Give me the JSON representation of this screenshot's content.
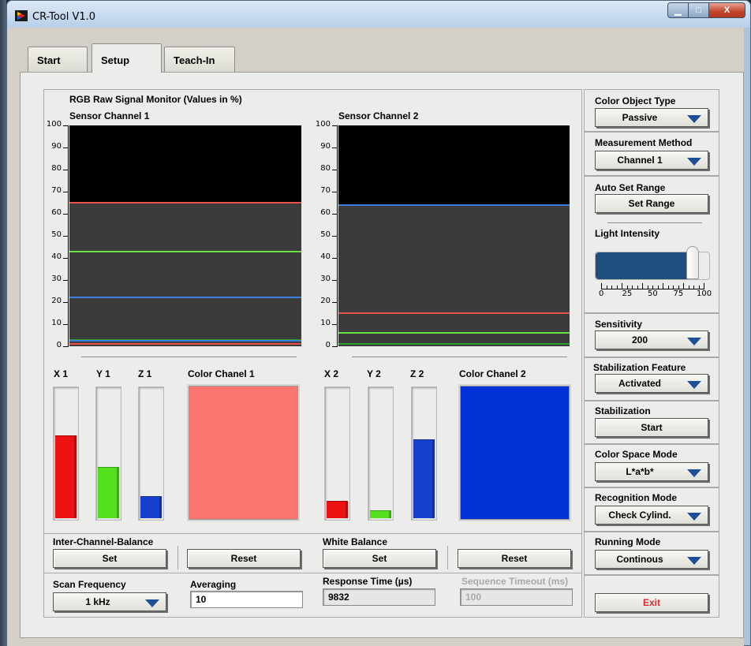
{
  "window": {
    "title": "CR-Tool V1.0",
    "min_glyph": "▁",
    "max_glyph": "□",
    "close_glyph": "X"
  },
  "tabs": [
    {
      "label": "Start",
      "active": false
    },
    {
      "label": "Setup",
      "active": true
    },
    {
      "label": "Teach-In",
      "active": false
    }
  ],
  "monitor": {
    "title": "RGB Raw Signal Monitor (Values in %)",
    "y_ticks": [
      "100",
      "90",
      "80",
      "70",
      "60",
      "50",
      "40",
      "30",
      "20",
      "10",
      "0"
    ]
  },
  "chart_data": [
    {
      "type": "line",
      "title": "Sensor Channel 1",
      "ylim": [
        0,
        100
      ],
      "y_ticks": [
        0,
        10,
        20,
        30,
        40,
        50,
        60,
        70,
        80,
        90,
        100
      ],
      "series": [
        {
          "color": "#e8504a",
          "value": 65
        },
        {
          "color": "#66e040",
          "value": 43
        },
        {
          "color": "#3d7fe0",
          "value": 22
        },
        {
          "color": "#2a9a2a",
          "value": 3
        },
        {
          "color": "#3d7fe0",
          "value": 2.5
        },
        {
          "color": "#e8504a",
          "value": 1
        }
      ],
      "fill_level": 65
    },
    {
      "type": "line",
      "title": "Sensor Channel 2",
      "ylim": [
        0,
        100
      ],
      "y_ticks": [
        0,
        10,
        20,
        30,
        40,
        50,
        60,
        70,
        80,
        90,
        100
      ],
      "series": [
        {
          "color": "#3d7fe0",
          "value": 64
        },
        {
          "color": "#e8504a",
          "value": 15
        },
        {
          "color": "#66e040",
          "value": 6
        },
        {
          "color": "#2a9a2a",
          "value": 1
        }
      ],
      "fill_level": 64
    }
  ],
  "channel1": {
    "x_label": "X 1",
    "y_label": "Y 1",
    "z_label": "Z 1",
    "swatch_label": "Color Chanel 1",
    "x_level": 0.63,
    "y_level": 0.39,
    "z_level": 0.17,
    "swatch_color": "#fb766e"
  },
  "channel2": {
    "x_label": "X 2",
    "y_label": "Y 2",
    "z_label": "Z 2",
    "swatch_label": "Color Chanel 2",
    "x_level": 0.13,
    "y_level": 0.06,
    "z_level": 0.6,
    "swatch_color": "#0331d8"
  },
  "colors": {
    "bar_red": "#ee1111",
    "bar_green": "#55e01e",
    "bar_blue": "#1740d0"
  },
  "inter_channel_balance": {
    "label": "Inter-Channel-Balance",
    "set": "Set",
    "reset": "Reset"
  },
  "white_balance": {
    "label": "White Balance",
    "set": "Set",
    "reset": "Reset"
  },
  "scan_frequency": {
    "label": "Scan Frequency",
    "value": "1 kHz"
  },
  "averaging": {
    "label": "Averaging",
    "value": "10"
  },
  "response_time": {
    "label": "Response Time (µs)",
    "value": "9832"
  },
  "sequence_timeout": {
    "label": "Sequence Timeout (ms)",
    "value": "100"
  },
  "right_panel": {
    "color_object_type": {
      "label": "Color Object Type",
      "value": "Passive"
    },
    "measurement_method": {
      "label": "Measurement Method",
      "value": "Channel 1"
    },
    "auto_set_range": {
      "label": "Auto Set Range",
      "button": "Set Range"
    },
    "light_intensity": {
      "label": "Light Intensity",
      "value": 85,
      "scale": [
        "0",
        "25",
        "50",
        "75",
        "100"
      ]
    },
    "sensitivity": {
      "label": "Sensitivity",
      "value": "200"
    },
    "stabilization_feature": {
      "label": "Stabilization Feature",
      "value": "Activated"
    },
    "stabilization": {
      "label": "Stabilization",
      "button": "Start"
    },
    "color_space_mode": {
      "label": "Color Space Mode",
      "value": "L*a*b*"
    },
    "recognition_mode": {
      "label": "Recognition Mode",
      "value": "Check Cylind."
    },
    "running_mode": {
      "label": "Running Mode",
      "value": "Continous"
    },
    "exit": "Exit"
  }
}
